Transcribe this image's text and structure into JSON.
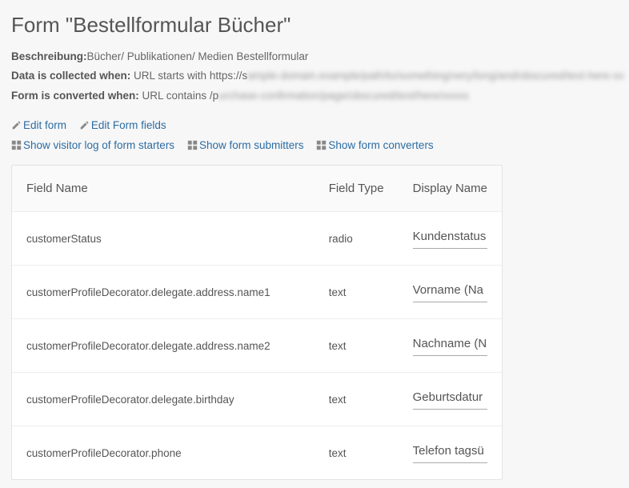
{
  "header": {
    "title": "Form \"Bestellformular Bücher\""
  },
  "meta": {
    "beschreibung_label": "Beschreibung:",
    "beschreibung_value": "Bücher/ Publikationen/ Medien Bestellformular",
    "collected_label": "Data is collected when:",
    "collected_prefix": " URL starts with https://s",
    "collected_blur": "ample-domain.example/path/to/something/very/long/and/obscured/text-here-xx",
    "converted_label": "Form is converted when:",
    "converted_prefix": " URL contains /p",
    "converted_blur": "urchase-confirmation/page/obscured/text/here/xxxxx"
  },
  "actions": {
    "edit_form": "Edit form",
    "edit_form_fields": "Edit Form fields",
    "show_starters": "Show visitor log of form starters",
    "show_submitters": "Show form submitters",
    "show_converters": "Show form converters"
  },
  "table": {
    "headers": {
      "field_name": "Field Name",
      "field_type": "Field Type",
      "display_name": "Display Name"
    },
    "rows": [
      {
        "name": "customerStatus",
        "type": "radio",
        "display": "Kundenstatus"
      },
      {
        "name": "customerProfileDecorator.delegate.address.name1",
        "type": "text",
        "display": "Vorname (Na"
      },
      {
        "name": "customerProfileDecorator.delegate.address.name2",
        "type": "text",
        "display": "Nachname (N"
      },
      {
        "name": "customerProfileDecorator.delegate.birthday",
        "type": "text",
        "display": "Geburtsdatur"
      },
      {
        "name": "customerProfileDecorator.phone",
        "type": "text",
        "display": "Telefon tagsü"
      }
    ]
  }
}
